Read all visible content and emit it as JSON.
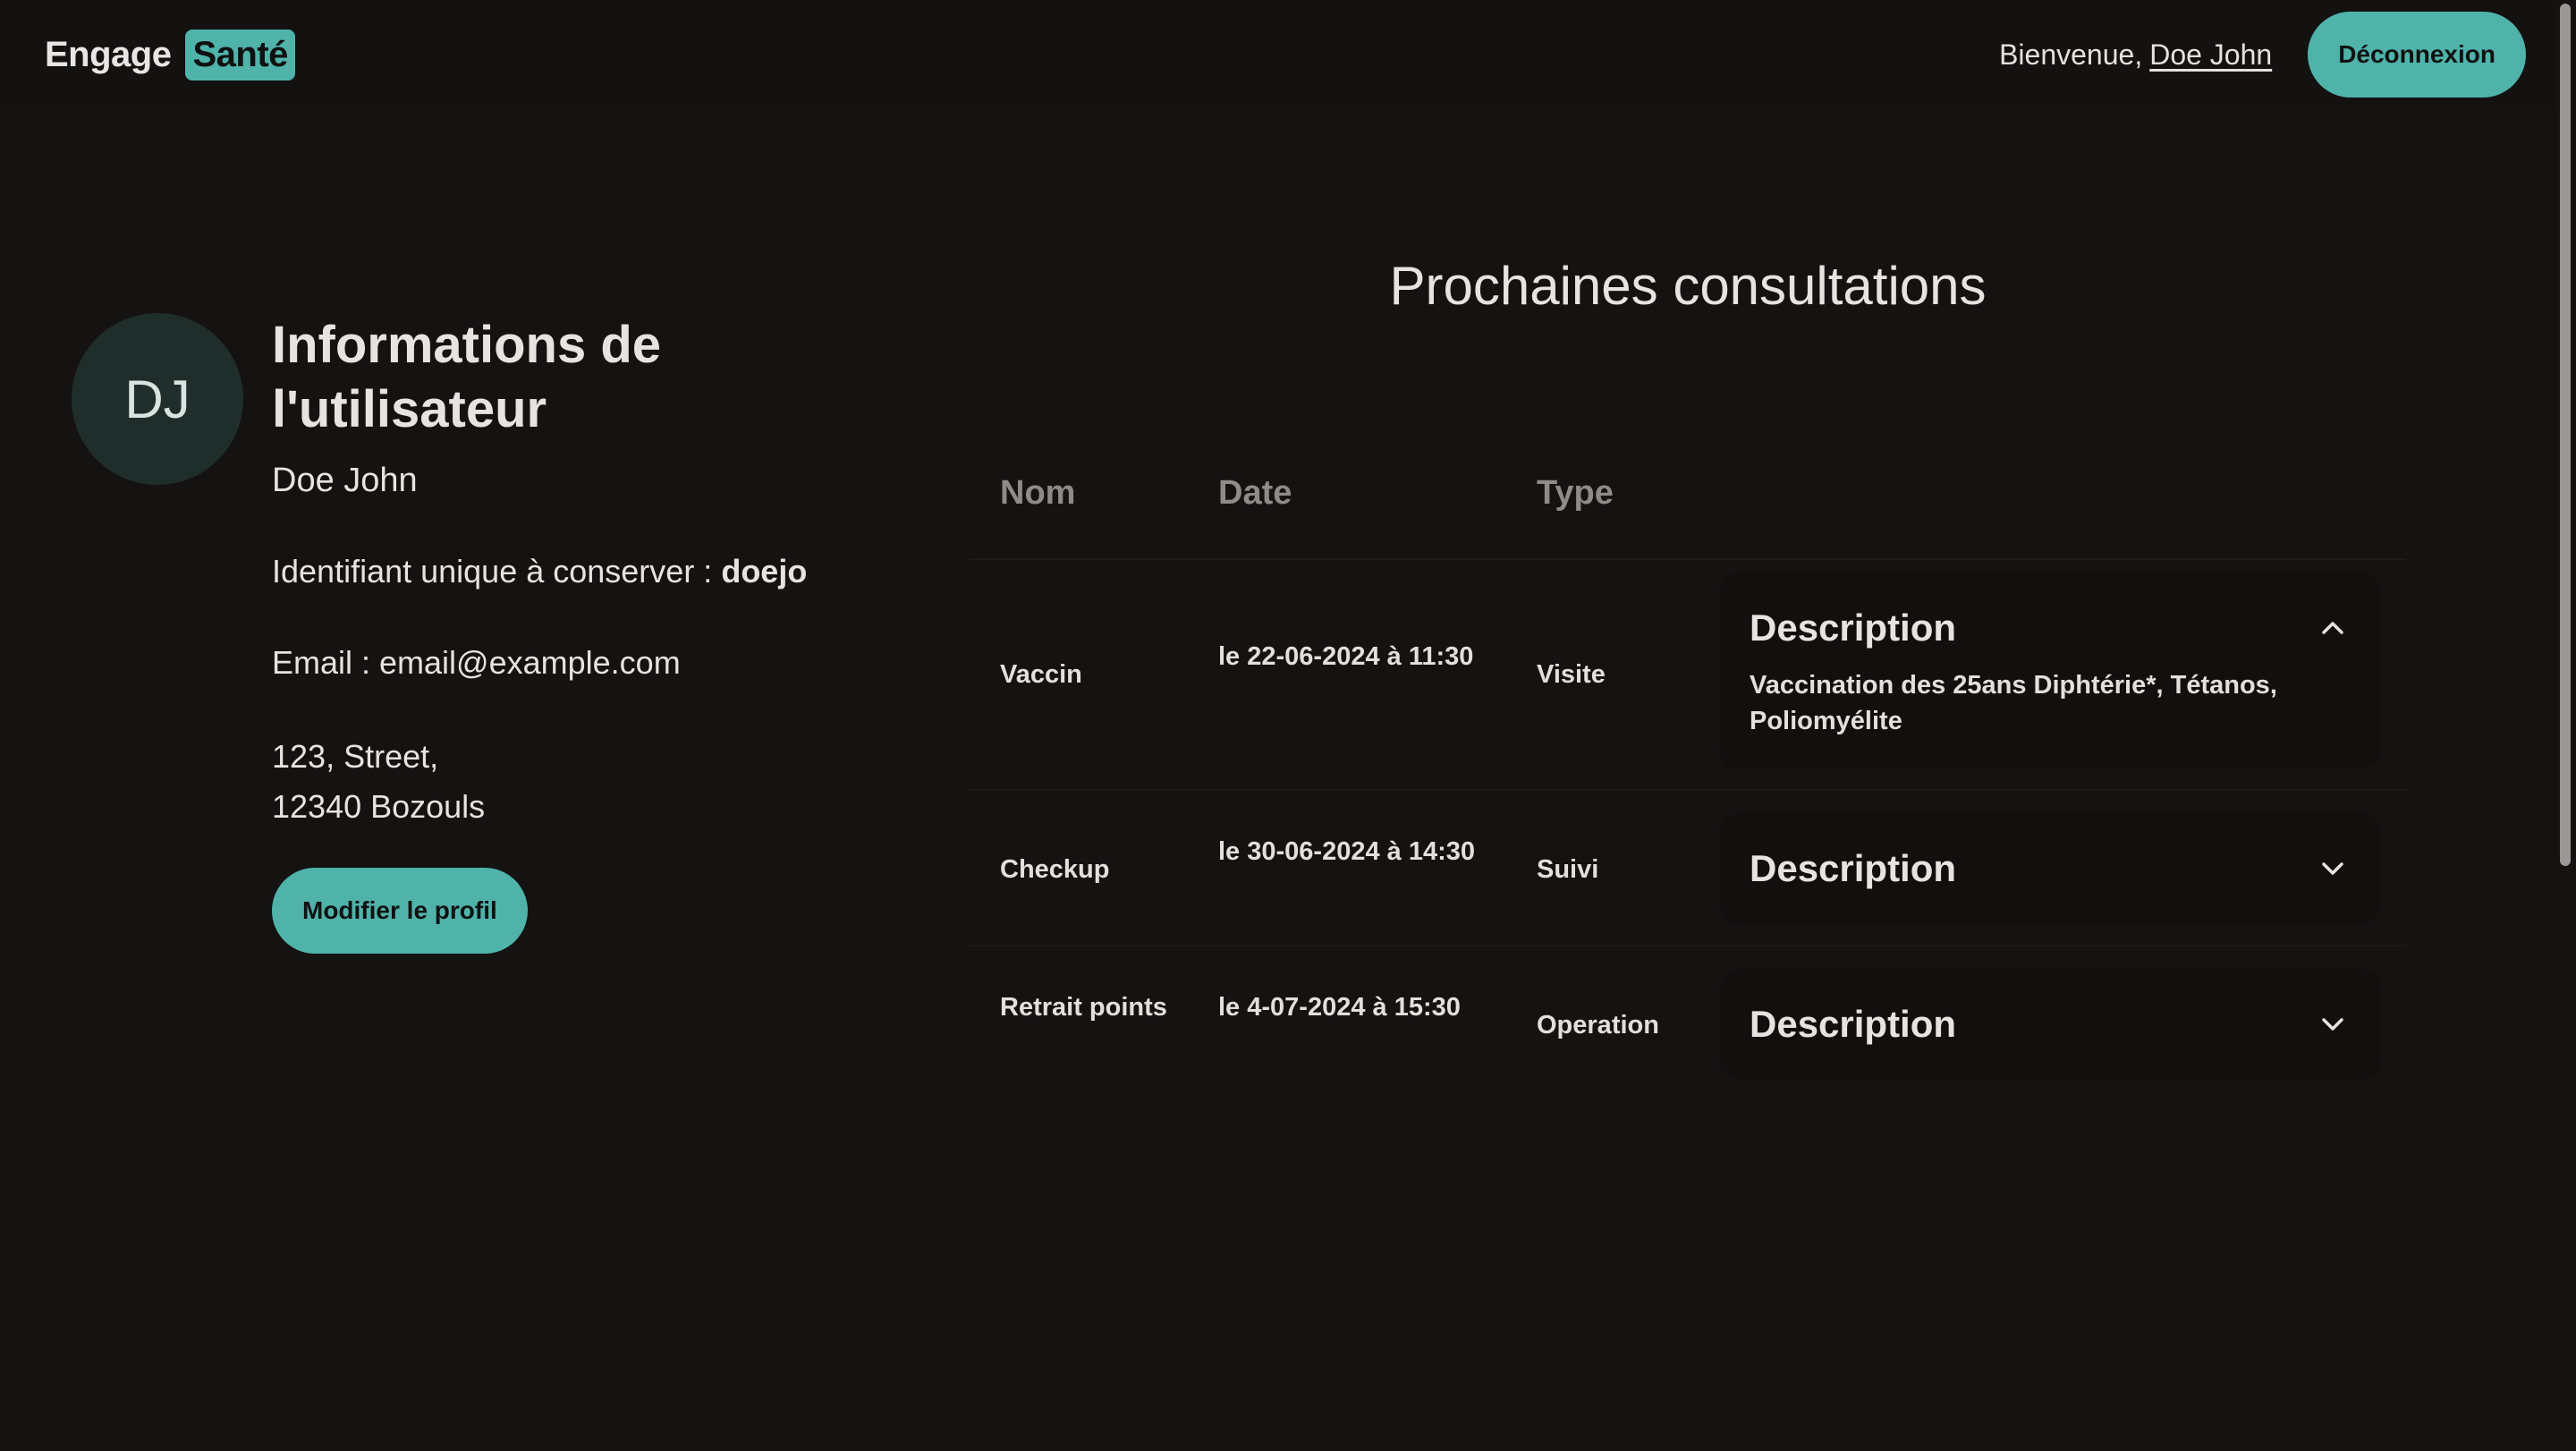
{
  "header": {
    "brand_main": "Engage",
    "brand_accent": "Santé",
    "welcome_prefix": "Bienvenue,",
    "welcome_user": "Doe John",
    "logout_label": "Déconnexion"
  },
  "user": {
    "initials": "DJ",
    "title": "Informations de l'utilisateur",
    "full_name": "Doe John",
    "id_label": "Identifiant unique à conserver :",
    "id_value": "doejo",
    "email_line": "Email : email@example.com",
    "address_line1": "123, Street,",
    "address_line2": "12340 Bozouls",
    "edit_label": "Modifier le profil"
  },
  "appointments": {
    "title": "Prochaines consultations",
    "columns": [
      "Nom",
      "Date",
      "Type"
    ],
    "rows": [
      {
        "nom": "Vaccin",
        "date": "le 22-06-2024 à 11:30",
        "type": "Visite",
        "desc_label": "Description",
        "desc_expanded": true,
        "desc_text": "Vaccination des 25ans Diphtérie*, Tétanos, Poliomyélite"
      },
      {
        "nom": "Checkup",
        "date": "le 30-06-2024 à 14:30",
        "type": "Suivi",
        "desc_label": "Description",
        "desc_expanded": false
      },
      {
        "nom": "Retrait points",
        "date": "le 4-07-2024 à 15:30",
        "type": "Operation",
        "desc_label": "Description",
        "desc_expanded": false
      }
    ]
  },
  "colors": {
    "accent": "#4fb3aa",
    "background": "#151212",
    "avatar_bg": "#1f2e2b"
  },
  "icons": {
    "expanded": "chevron-up-icon",
    "collapsed": "chevron-down-icon"
  }
}
